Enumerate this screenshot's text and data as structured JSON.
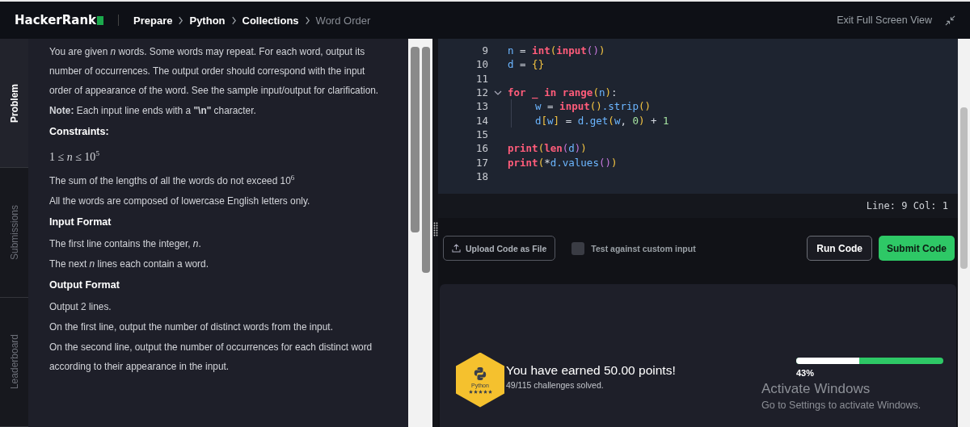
{
  "header": {
    "logo": "HackerRank",
    "breadcrumbs": [
      {
        "label": "Prepare",
        "current": false
      },
      {
        "label": "Python",
        "current": false
      },
      {
        "label": "Collections",
        "current": false
      },
      {
        "label": "Word Order",
        "current": true
      }
    ],
    "exit_link": "Exit Full Screen View"
  },
  "side_tabs": [
    {
      "label": "Problem",
      "selected": true
    },
    {
      "label": "Submissions",
      "selected": false
    },
    {
      "label": "Leaderboard",
      "selected": false
    }
  ],
  "problem": [
    {
      "kind": "text",
      "text": "You are given *n* words. Some words may repeat. For each word, output its number of occurrences. The output order should correspond with the input order of appearance of the word. See the sample input/output for clarification."
    },
    {
      "kind": "text",
      "text": "**Note:** Each input line ends with a **\"\\n\"** character."
    },
    {
      "kind": "heading",
      "text": "Constraints:"
    },
    {
      "kind": "math",
      "text": "1 ≤ *n* ≤ 10$^{5}$"
    },
    {
      "kind": "text",
      "text": "The sum of the lengths of all the words do not exceed 10$^{6}$"
    },
    {
      "kind": "text",
      "text": "All the words are composed of lowercase English letters only."
    },
    {
      "kind": "heading",
      "text": "Input Format"
    },
    {
      "kind": "text",
      "text": "The first line contains the integer, *n*."
    },
    {
      "kind": "text",
      "text": "The next *n* lines each contain a word."
    },
    {
      "kind": "heading",
      "text": "Output Format"
    },
    {
      "kind": "text",
      "text": "Output 2 lines."
    },
    {
      "kind": "text",
      "text": "On the first line, output the number of distinct words from the input."
    },
    {
      "kind": "text",
      "text": "On the second line, output the number of occurrences for each distinct word according to their appearance in the input."
    }
  ],
  "editor": {
    "lines": [
      {
        "number": "9",
        "fold": false,
        "tokens": [
          {
            "kind": "var",
            "text": "n"
          },
          {
            "kind": "op",
            "text": " = "
          },
          {
            "kind": "builtin",
            "text": "int"
          },
          {
            "kind": "paren",
            "text": "("
          },
          {
            "kind": "builtin",
            "text": "input"
          },
          {
            "kind": "paren2",
            "text": "()"
          },
          {
            "kind": "paren",
            "text": ")"
          }
        ]
      },
      {
        "number": "10",
        "fold": false,
        "tokens": [
          {
            "kind": "var",
            "text": "d"
          },
          {
            "kind": "op",
            "text": " = "
          },
          {
            "kind": "paren",
            "text": "{}"
          }
        ]
      },
      {
        "number": "11",
        "fold": false
      },
      {
        "number": "12",
        "fold": true,
        "tokens": [
          {
            "kind": "keyword",
            "text": "for _ in"
          },
          {
            "kind": "builtin",
            "text": " range"
          },
          {
            "kind": "paren",
            "text": "("
          },
          {
            "kind": "var",
            "text": "n"
          },
          {
            "kind": "paren",
            "text": ")"
          },
          {
            "kind": "op",
            "text": ":"
          }
        ],
        "children": [
          {
            "number": "13",
            "fold": false,
            "tokens": [
              {
                "kind": "var",
                "text": "w"
              },
              {
                "kind": "op",
                "text": " = "
              },
              {
                "kind": "builtin",
                "text": "input"
              },
              {
                "kind": "paren",
                "text": "()"
              },
              {
                "kind": "var",
                "text": ".strip"
              },
              {
                "kind": "paren",
                "text": "()"
              }
            ]
          },
          {
            "number": "14",
            "fold": false,
            "tokens": [
              {
                "kind": "var",
                "text": "d"
              },
              {
                "kind": "paren",
                "text": "["
              },
              {
                "kind": "var",
                "text": "w"
              },
              {
                "kind": "paren",
                "text": "]"
              },
              {
                "kind": "op",
                "text": " = "
              },
              {
                "kind": "var",
                "text": "d.get"
              },
              {
                "kind": "paren",
                "text": "("
              },
              {
                "kind": "var",
                "text": "w"
              },
              {
                "kind": "op",
                "text": ", "
              },
              {
                "kind": "number",
                "text": "0"
              },
              {
                "kind": "paren",
                "text": ")"
              },
              {
                "kind": "op",
                "text": " + "
              },
              {
                "kind": "number",
                "text": "1"
              }
            ]
          }
        ]
      },
      {
        "number": "15",
        "fold": false
      },
      {
        "number": "16",
        "fold": false,
        "tokens": [
          {
            "kind": "builtin",
            "text": "print"
          },
          {
            "kind": "paren",
            "text": "("
          },
          {
            "kind": "builtin",
            "text": "len"
          },
          {
            "kind": "paren2",
            "text": "("
          },
          {
            "kind": "var",
            "text": "d"
          },
          {
            "kind": "paren2",
            "text": ")"
          },
          {
            "kind": "paren",
            "text": ")"
          }
        ]
      },
      {
        "number": "17",
        "fold": false,
        "tokens": [
          {
            "kind": "builtin",
            "text": "print"
          },
          {
            "kind": "paren",
            "text": "("
          },
          {
            "kind": "op",
            "text": "*"
          },
          {
            "kind": "var",
            "text": "d.values"
          },
          {
            "kind": "paren2",
            "text": "()"
          },
          {
            "kind": "paren",
            "text": ")"
          }
        ]
      },
      {
        "number": "18",
        "fold": false
      }
    ],
    "status": "Line: 9 Col: 1"
  },
  "actions": {
    "upload": "Upload Code as File",
    "custom_input": {
      "label": "Test against custom input",
      "checked": false
    },
    "run": "Run Code",
    "submit": "Submit Code"
  },
  "result": {
    "badge": {
      "label": "Python",
      "stars": 5
    },
    "title": "You have earned 50.00 points!",
    "subtitle": "49/115 challenges solved.",
    "progress": {
      "level": 0.43,
      "reading": "43%"
    }
  },
  "os_notice": {
    "title": "Activate Windows",
    "subtitle": "Go to Settings to activate Windows."
  }
}
